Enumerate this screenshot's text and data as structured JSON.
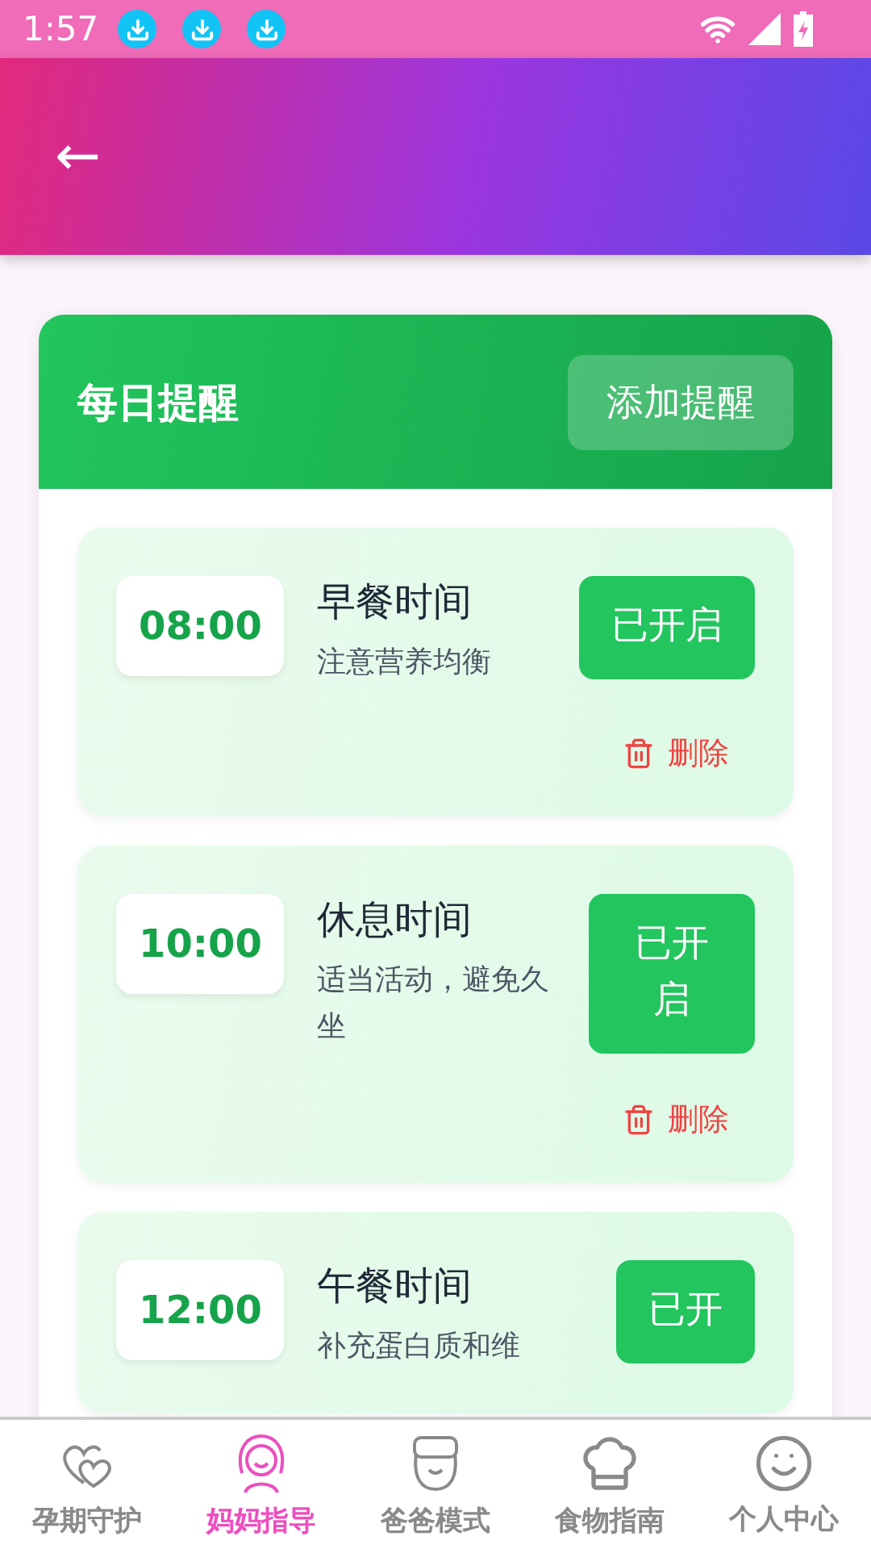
{
  "status_bar": {
    "time": "1:57"
  },
  "header": {
    "back": "←"
  },
  "card": {
    "title": "每日提醒",
    "add_button": "添加提醒",
    "reminders": [
      {
        "time": "08:00",
        "title": "早餐时间",
        "description": "注意营养均衡",
        "toggle": "已开启",
        "on": true,
        "delete": "删除"
      },
      {
        "time": "10:00",
        "title": "休息时间",
        "description": "适当活动，避免久坐",
        "toggle": "已开启",
        "on": true,
        "delete": "删除"
      },
      {
        "time": "12:00",
        "title": "午餐时间",
        "description": "补充蛋白质和维",
        "toggle": "已开",
        "on": true
      }
    ]
  },
  "bottom_nav": [
    {
      "label": "孕期守护",
      "kind": "hearts",
      "selected": false
    },
    {
      "label": "妈妈指导",
      "kind": "mom",
      "selected": true
    },
    {
      "label": "爸爸模式",
      "kind": "dad",
      "selected": false
    },
    {
      "label": "食物指南",
      "kind": "chef",
      "selected": false
    },
    {
      "label": "个人中心",
      "kind": "smile",
      "selected": false
    }
  ]
}
